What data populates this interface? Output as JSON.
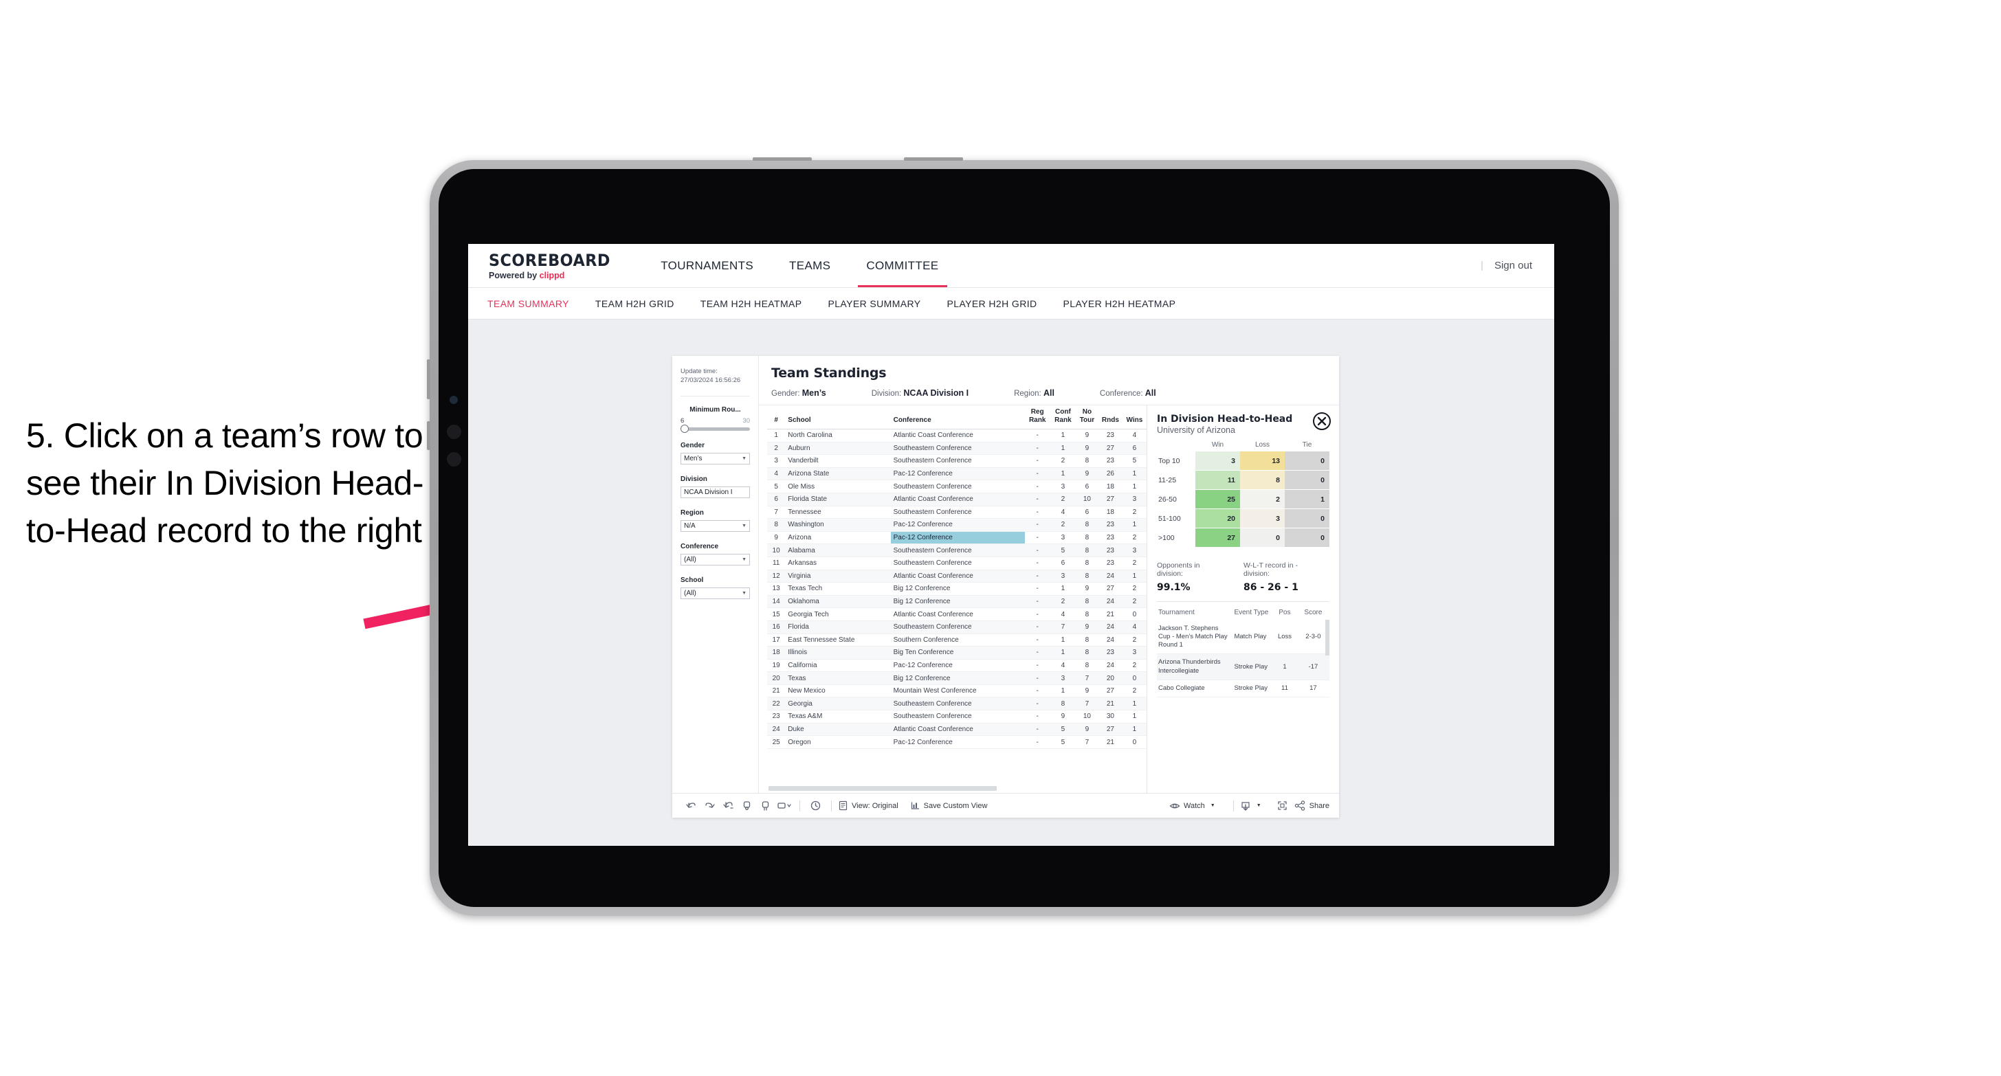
{
  "caption": {
    "text": "5. Click on a team’s row to see their In Division Head-to-Head record to the right"
  },
  "colors": {
    "accent_pink": "#e8315b",
    "arrow_pink": "#f0225f",
    "highlight_blue": "#97cede",
    "device_bezel": "#a7a7a9"
  },
  "app": {
    "logo": {
      "main": "SCOREBOARD",
      "powered_prefix": "Powered by ",
      "brand": "clippd"
    },
    "topnav": [
      {
        "label": "TOURNAMENTS",
        "active": false
      },
      {
        "label": "TEAMS",
        "active": false
      },
      {
        "label": "COMMITTEE",
        "active": true
      }
    ],
    "signout": {
      "divider": "|",
      "label": "Sign out"
    },
    "subnav": [
      {
        "label": "TEAM SUMMARY",
        "active": true
      },
      {
        "label": "TEAM H2H GRID",
        "active": false
      },
      {
        "label": "TEAM H2H HEATMAP",
        "active": false
      },
      {
        "label": "PLAYER SUMMARY",
        "active": false
      },
      {
        "label": "PLAYER H2H GRID",
        "active": false
      },
      {
        "label": "PLAYER H2H HEATMAP",
        "active": false
      }
    ]
  },
  "filters": {
    "update_time_label": "Update time:",
    "update_time_value": "27/03/2024 16:56:26",
    "minimum_rounds": {
      "label": "Minimum Rou...",
      "min": "6",
      "max": "30"
    },
    "gender": {
      "label": "Gender",
      "value": "Men’s"
    },
    "division": {
      "label": "Division",
      "value": "NCAA Division I"
    },
    "region": {
      "label": "Region",
      "value": "N/A"
    },
    "conference": {
      "label": "Conference",
      "value": "(All)"
    },
    "school": {
      "label": "School",
      "value": "(All)"
    }
  },
  "viz": {
    "title": "Team Standings",
    "header_filters": [
      {
        "label": "Gender:",
        "value": "Men’s"
      },
      {
        "label": "Division:",
        "value": "NCAA Division I"
      },
      {
        "label": "Region:",
        "value": "All"
      },
      {
        "label": "Conference:",
        "value": "All"
      }
    ]
  },
  "chart_data": {
    "type": "table",
    "title": "Team Standings",
    "columns": [
      "#",
      "School",
      "Conference",
      "Reg Rank",
      "Conf Rank",
      "No Tour",
      "Rnds",
      "Wins"
    ],
    "column_headers_two_line": [
      {
        "l1": "#",
        "l2": ""
      },
      {
        "l1": "School",
        "l2": ""
      },
      {
        "l1": "Conference",
        "l2": ""
      },
      {
        "l1": "Reg",
        "l2": "Rank"
      },
      {
        "l1": "Conf",
        "l2": "Rank"
      },
      {
        "l1": "No",
        "l2": "Tour"
      },
      {
        "l1": "Rnds",
        "l2": ""
      },
      {
        "l1": "Wins",
        "l2": ""
      }
    ],
    "selected_row": 9,
    "rows": [
      {
        "rank": "1",
        "school": "North Carolina",
        "conference": "Atlantic Coast Conference",
        "reg": "-",
        "conf": "1",
        "notour": "9",
        "rnds": "23",
        "wins": "4"
      },
      {
        "rank": "2",
        "school": "Auburn",
        "conference": "Southeastern Conference",
        "reg": "-",
        "conf": "1",
        "notour": "9",
        "rnds": "27",
        "wins": "6"
      },
      {
        "rank": "3",
        "school": "Vanderbilt",
        "conference": "Southeastern Conference",
        "reg": "-",
        "conf": "2",
        "notour": "8",
        "rnds": "23",
        "wins": "5"
      },
      {
        "rank": "4",
        "school": "Arizona State",
        "conference": "Pac-12 Conference",
        "reg": "-",
        "conf": "1",
        "notour": "9",
        "rnds": "26",
        "wins": "1"
      },
      {
        "rank": "5",
        "school": "Ole Miss",
        "conference": "Southeastern Conference",
        "reg": "-",
        "conf": "3",
        "notour": "6",
        "rnds": "18",
        "wins": "1"
      },
      {
        "rank": "6",
        "school": "Florida State",
        "conference": "Atlantic Coast Conference",
        "reg": "-",
        "conf": "2",
        "notour": "10",
        "rnds": "27",
        "wins": "3"
      },
      {
        "rank": "7",
        "school": "Tennessee",
        "conference": "Southeastern Conference",
        "reg": "-",
        "conf": "4",
        "notour": "6",
        "rnds": "18",
        "wins": "2"
      },
      {
        "rank": "8",
        "school": "Washington",
        "conference": "Pac-12 Conference",
        "reg": "-",
        "conf": "2",
        "notour": "8",
        "rnds": "23",
        "wins": "1"
      },
      {
        "rank": "9",
        "school": "Arizona",
        "conference": "Pac-12 Conference",
        "reg": "-",
        "conf": "3",
        "notour": "8",
        "rnds": "23",
        "wins": "2",
        "highlight": true
      },
      {
        "rank": "10",
        "school": "Alabama",
        "conference": "Southeastern Conference",
        "reg": "-",
        "conf": "5",
        "notour": "8",
        "rnds": "23",
        "wins": "3"
      },
      {
        "rank": "11",
        "school": "Arkansas",
        "conference": "Southeastern Conference",
        "reg": "-",
        "conf": "6",
        "notour": "8",
        "rnds": "23",
        "wins": "2"
      },
      {
        "rank": "12",
        "school": "Virginia",
        "conference": "Atlantic Coast Conference",
        "reg": "-",
        "conf": "3",
        "notour": "8",
        "rnds": "24",
        "wins": "1"
      },
      {
        "rank": "13",
        "school": "Texas Tech",
        "conference": "Big 12 Conference",
        "reg": "-",
        "conf": "1",
        "notour": "9",
        "rnds": "27",
        "wins": "2"
      },
      {
        "rank": "14",
        "school": "Oklahoma",
        "conference": "Big 12 Conference",
        "reg": "-",
        "conf": "2",
        "notour": "8",
        "rnds": "24",
        "wins": "2"
      },
      {
        "rank": "15",
        "school": "Georgia Tech",
        "conference": "Atlantic Coast Conference",
        "reg": "-",
        "conf": "4",
        "notour": "8",
        "rnds": "21",
        "wins": "0"
      },
      {
        "rank": "16",
        "school": "Florida",
        "conference": "Southeastern Conference",
        "reg": "-",
        "conf": "7",
        "notour": "9",
        "rnds": "24",
        "wins": "4"
      },
      {
        "rank": "17",
        "school": "East Tennessee State",
        "conference": "Southern Conference",
        "reg": "-",
        "conf": "1",
        "notour": "8",
        "rnds": "24",
        "wins": "2"
      },
      {
        "rank": "18",
        "school": "Illinois",
        "conference": "Big Ten Conference",
        "reg": "-",
        "conf": "1",
        "notour": "8",
        "rnds": "23",
        "wins": "3"
      },
      {
        "rank": "19",
        "school": "California",
        "conference": "Pac-12 Conference",
        "reg": "-",
        "conf": "4",
        "notour": "8",
        "rnds": "24",
        "wins": "2"
      },
      {
        "rank": "20",
        "school": "Texas",
        "conference": "Big 12 Conference",
        "reg": "-",
        "conf": "3",
        "notour": "7",
        "rnds": "20",
        "wins": "0"
      },
      {
        "rank": "21",
        "school": "New Mexico",
        "conference": "Mountain West Conference",
        "reg": "-",
        "conf": "1",
        "notour": "9",
        "rnds": "27",
        "wins": "2"
      },
      {
        "rank": "22",
        "school": "Georgia",
        "conference": "Southeastern Conference",
        "reg": "-",
        "conf": "8",
        "notour": "7",
        "rnds": "21",
        "wins": "1"
      },
      {
        "rank": "23",
        "school": "Texas A&M",
        "conference": "Southeastern Conference",
        "reg": "-",
        "conf": "9",
        "notour": "10",
        "rnds": "30",
        "wins": "1"
      },
      {
        "rank": "24",
        "school": "Duke",
        "conference": "Atlantic Coast Conference",
        "reg": "-",
        "conf": "5",
        "notour": "9",
        "rnds": "27",
        "wins": "1"
      },
      {
        "rank": "25",
        "school": "Oregon",
        "conference": "Pac-12 Conference",
        "reg": "-",
        "conf": "5",
        "notour": "7",
        "rnds": "21",
        "wins": "0"
      }
    ]
  },
  "h2h": {
    "title": "In Division Head-to-Head",
    "subtitle": "University of Arizona",
    "close_icon": "close-icon",
    "matrix": {
      "type": "heatmap",
      "columns": [
        "Win",
        "Loss",
        "Tie"
      ],
      "rows": [
        "Top 10",
        "11-25",
        "26-50",
        "51-100",
        ">100"
      ],
      "values": [
        {
          "band": "Top 10",
          "win": "3",
          "loss": "13",
          "tie": "0",
          "win_color": "#e3efe0",
          "loss_color": "#f2e09a",
          "tie_color": "#d5d5d5"
        },
        {
          "band": "11-25",
          "win": "11",
          "loss": "8",
          "tie": "0",
          "win_color": "#c4e5bb",
          "loss_color": "#f5ecce",
          "tie_color": "#d5d5d5"
        },
        {
          "band": "26-50",
          "win": "25",
          "loss": "2",
          "tie": "1",
          "win_color": "#89d183",
          "loss_color": "#f2f2ef",
          "tie_color": "#d5d5d5"
        },
        {
          "band": "51-100",
          "win": "20",
          "loss": "3",
          "tie": "0",
          "win_color": "#aadfa0",
          "loss_color": "#f4efe6",
          "tie_color": "#d5d5d5"
        },
        {
          "band": ">100",
          "win": "27",
          "loss": "0",
          "tie": "0",
          "win_color": "#8bd285",
          "loss_color": "#f0f0ee",
          "tie_color": "#d5d5d5"
        }
      ]
    },
    "stats": [
      {
        "label": "Opponents in division:",
        "value": "99.1%"
      },
      {
        "label": "W-L-T record in -division:",
        "value": "86 - 26 - 1"
      }
    ],
    "tournaments": {
      "columns": [
        "Tournament",
        "Event Type",
        "Pos",
        "Score"
      ],
      "rows": [
        {
          "tournament": "Jackson T. Stephens Cup - Men’s Match Play Round 1",
          "event_type": "Match Play",
          "pos": "Loss",
          "score": "2-3-0"
        },
        {
          "tournament": "Arizona Thunderbirds Intercollegiate",
          "event_type": "Stroke Play",
          "pos": "1",
          "score": "-17"
        },
        {
          "tournament": "Cabo Collegiate",
          "event_type": "Stroke Play",
          "pos": "11",
          "score": "17"
        }
      ]
    }
  },
  "toolbar": {
    "icons": [
      "undo-icon",
      "redo-icon",
      "revert-icon",
      "refresh-icon",
      "pause-icon",
      "rectangle-select-icon"
    ],
    "view_original_label": "View: Original",
    "save_custom_view_label": "Save Custom View",
    "watch_label": "Watch",
    "share_label": "Share",
    "download_icon": "download-icon",
    "fullscreen_icon": "fullscreen-icon"
  }
}
